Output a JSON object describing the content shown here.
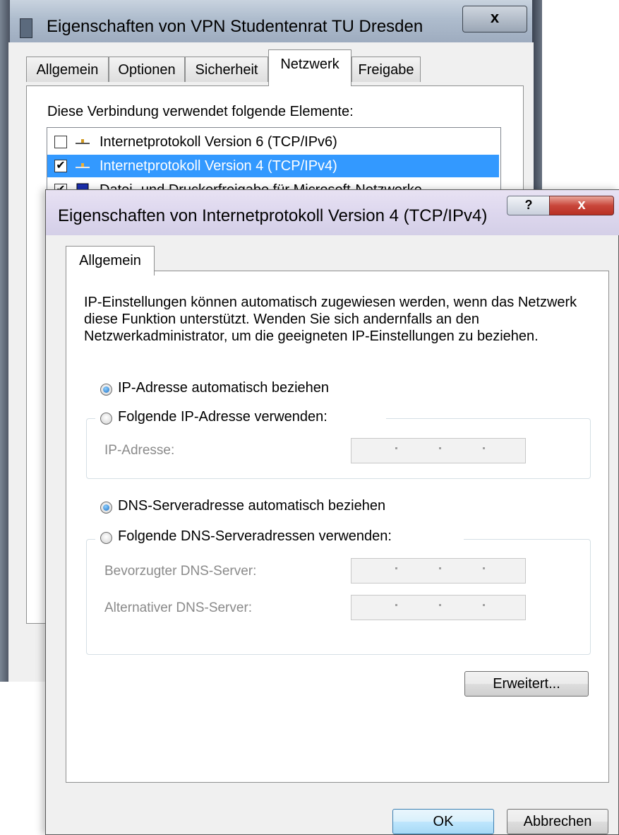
{
  "background_window": {
    "title": "Eigenschaften von VPN Studentenrat TU Dresden",
    "close_label": "x",
    "tabs": [
      {
        "label": "Allgemein"
      },
      {
        "label": "Optionen"
      },
      {
        "label": "Sicherheit"
      },
      {
        "label": "Netzwerk",
        "active": true
      },
      {
        "label": "Freigabe"
      }
    ],
    "components_label": "Diese Verbindung verwendet folgende Elemente:",
    "components": [
      {
        "label": "Internetprotokoll Version 6 (TCP/IPv6)",
        "checked": false,
        "selected": false
      },
      {
        "label": "Internetprotokoll Version 4 (TCP/IPv4)",
        "checked": true,
        "selected": true
      },
      {
        "label": "Datei- und Druckerfreigabe für Microsoft-Netzwerke",
        "checked": true,
        "selected": false
      }
    ]
  },
  "dialog": {
    "title": "Eigenschaften von Internetprotokoll Version 4 (TCP/IPv4)",
    "help_label": "?",
    "close_label": "x",
    "tab": "Allgemein",
    "description": "IP-Einstellungen können automatisch zugewiesen werden, wenn das Netzwerk diese Funktion unterstützt. Wenden Sie sich andernfalls an den Netzwerkadministrator, um die geeigneten IP-Einstellungen zu beziehen.",
    "ip": {
      "auto_label": "IP-Adresse automatisch beziehen",
      "manual_label": "Folgende IP-Adresse verwenden:",
      "selected": "auto",
      "address_label": "IP-Adresse:",
      "address_value": ". . ."
    },
    "dns": {
      "auto_label": "DNS-Serveradresse automatisch beziehen",
      "manual_label": "Folgende DNS-Serveradressen verwenden:",
      "selected": "auto",
      "preferred_label": "Bevorzugter DNS-Server:",
      "alternate_label": "Alternativer DNS-Server:"
    },
    "advanced_label": "Erweitert...",
    "ok_label": "OK",
    "cancel_label": "Abbrechen"
  },
  "colors": {
    "selection": "#3399ff",
    "dialog_title": "#ddd7ee",
    "close_red": "#c9473b"
  }
}
